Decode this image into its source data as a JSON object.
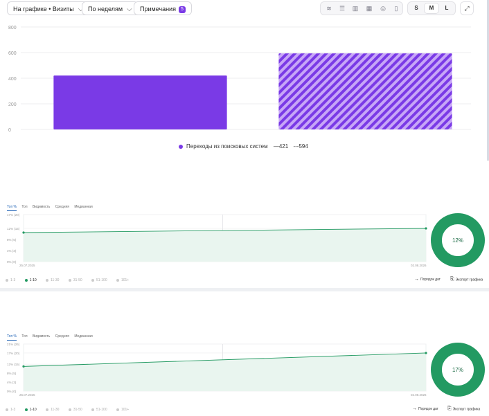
{
  "toolbar": {
    "graph_select": "На графике • Визиты",
    "period_select": "По неделям",
    "notes_label": "Примечания",
    "notes_count": "5",
    "sizes": [
      "S",
      "M",
      "L"
    ],
    "active_size": "M",
    "view_icons": [
      "line-chart-icon",
      "stacked-area-icon",
      "bar-chart-icon",
      "table-chart-icon",
      "pie-chart-icon",
      "column-chart-icon"
    ]
  },
  "chart_data": [
    {
      "type": "bar",
      "categories": [
        "",
        ""
      ],
      "series": [
        {
          "name": "Переходы из поисковых систем",
          "values": [
            421,
            594
          ]
        }
      ],
      "ylim": [
        0,
        800
      ],
      "yticks": [
        "0",
        "200",
        "400",
        "600",
        "800"
      ],
      "bar_styles": [
        "solid",
        "hatched"
      ],
      "colors": {
        "bar": "#7a3ae6",
        "hatch": "#c7a6f7"
      },
      "grid": true,
      "legend": {
        "label": "Переходы из поисковых систем",
        "solid_value": "421",
        "dashed_value": "594",
        "solid_marker": "—",
        "dashed_marker": "---"
      }
    },
    {
      "type": "area",
      "x": [
        "25.07.2025",
        "02.08.2026"
      ],
      "values": [
        10.5,
        12
      ],
      "ylim": [
        0,
        17
      ],
      "yticks": [
        "0% (0)",
        "4% (3)",
        "8% (5)",
        "12% (15)",
        "17% (20)"
      ],
      "xticks": [
        "25.07.2025",
        "02.08.2026"
      ],
      "donut_label": "12%",
      "color": "#239a62"
    },
    {
      "type": "area",
      "x": [
        "25.07.2025",
        "02.08.2026"
      ],
      "values": [
        11,
        17
      ],
      "ylim": [
        0,
        21
      ],
      "yticks": [
        "0% (0)",
        "4% (3)",
        "8% (5)",
        "12% (15)",
        "17% (20)",
        "21% (26)"
      ],
      "xticks": [
        "25.07.2025",
        "02.08.2026"
      ],
      "donut_label": "17%",
      "color": "#239a62"
    }
  ],
  "widgets": [
    {
      "tabs": [
        "Топ %",
        "Топ",
        "Видимость",
        "Средняя",
        "Медианная"
      ],
      "active_tab": 0,
      "filters": [
        "1-3",
        "1-10",
        "11-30",
        "31-50",
        "51-100",
        "101+"
      ],
      "active_filter": 1,
      "date_order_label": "Порядок дат",
      "export_label": "Экспорт графика"
    },
    {
      "tabs": [
        "Топ %",
        "Топ",
        "Видимость",
        "Средняя",
        "Медианная"
      ],
      "active_tab": 0,
      "filters": [
        "1-3",
        "1-10",
        "11-30",
        "31-50",
        "51-100",
        "101+"
      ],
      "active_filter": 1,
      "date_order_label": "Порядок дат",
      "export_label": "Экспорт графика"
    }
  ]
}
